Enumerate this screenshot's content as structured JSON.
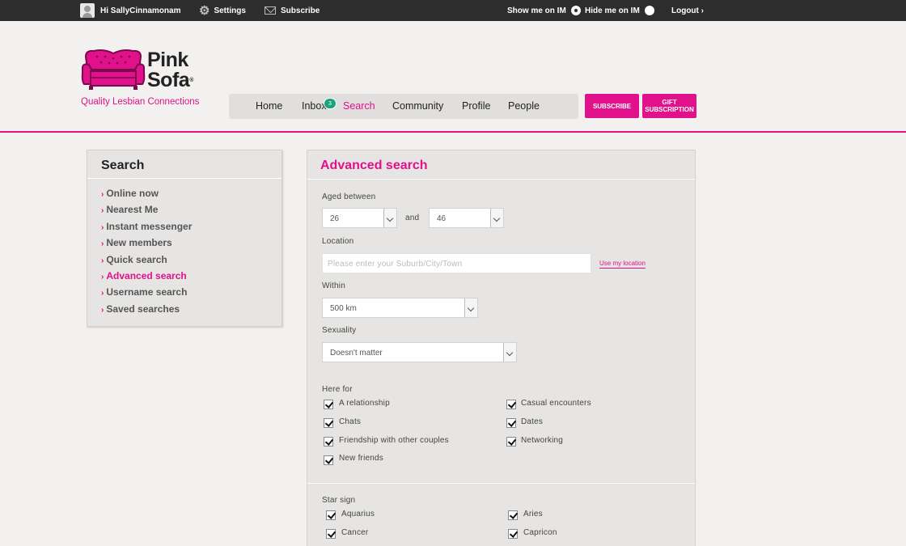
{
  "topbar": {
    "greeting": "Hi SallyCinnamonam",
    "settings": "Settings",
    "subscribe": "Subscribe",
    "show_im": "Show me on IM",
    "hide_im": "Hide me on IM",
    "logout": "Logout ›"
  },
  "brand": {
    "line1": "Pink",
    "line2": "Sofa",
    "reg": "®",
    "tagline": "Quality Lesbian Connections"
  },
  "nav": {
    "home": "Home",
    "inbox": "Inbox",
    "inbox_badge": "3",
    "search": "Search",
    "community": "Community",
    "profile": "Profile",
    "people": "People"
  },
  "buttons": {
    "subscribe": "SUBSCRIBE",
    "gift_line1": "GIFT",
    "gift_line2": "SUBSCRIPTION"
  },
  "sidebar": {
    "title": "Search",
    "items": [
      "Online now",
      "Nearest Me",
      "Instant messenger",
      "New members",
      "Quick search",
      "Advanced search",
      "Username search",
      "Saved searches"
    ]
  },
  "form": {
    "title": "Advanced search",
    "aged_label": "Aged between",
    "age_min": "26",
    "and": "and",
    "age_max": "46",
    "location_label": "Location",
    "location_placeholder": "Please enter your Suburb/City/Town",
    "use_location": "Use my location",
    "within_label": "Within",
    "within_value": "500 km",
    "sexuality_label": "Sexuality",
    "sexuality_value": "Doesn't matter",
    "here_for_label": "Here for",
    "here_for": [
      "A relationship",
      "Casual encounters",
      "Chats",
      "Dates",
      "Friendship with other couples",
      "Networking",
      "New friends"
    ],
    "star_sign_label": "Star sign",
    "star_signs": [
      "Aquarius",
      "Aries",
      "Cancer",
      "Capricon"
    ]
  },
  "colors": {
    "brand_pink": "#e0118a",
    "topbar": "#2d2d2d",
    "badge": "#1aa37e"
  }
}
